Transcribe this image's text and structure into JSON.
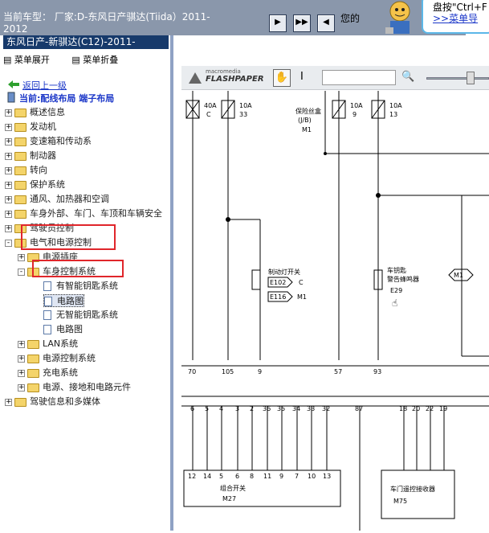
{
  "header": {
    "title": "当前车型： 厂家:D-东风日产骐达(Tiida）2011-2012",
    "message": "您的",
    "help_line1": "盘按\"Ctrl+F",
    "help_line2": ">>菜单导"
  },
  "toolbar": {
    "buttons": [
      {
        "icon": "play-icon"
      },
      {
        "icon": "skip-icon"
      },
      {
        "icon": "prev-icon"
      }
    ]
  },
  "sidebar": {
    "car": "东风日产-新骐达(C12)-2011-",
    "expand": "菜单展开",
    "collapse": "菜单折叠",
    "back": "返回上一级",
    "current": "当前:配线布局 端子布局",
    "items": [
      {
        "label": "概述信息",
        "state": "+",
        "level": 0
      },
      {
        "label": "发动机",
        "state": "+",
        "level": 0
      },
      {
        "label": "变速箱和传动系",
        "state": "+",
        "level": 0
      },
      {
        "label": "制动器",
        "state": "+",
        "level": 0
      },
      {
        "label": "转向",
        "state": "+",
        "level": 0
      },
      {
        "label": "保护系统",
        "state": "+",
        "level": 0
      },
      {
        "label": "通风、加热器和空调",
        "state": "+",
        "level": 0
      },
      {
        "label": "车身外部、车门、车顶和车辆安全",
        "state": "+",
        "level": 0
      },
      {
        "label": "驾驶员控制",
        "state": "+",
        "level": 0
      },
      {
        "label": "电气和电源控制",
        "state": "-",
        "level": 0
      },
      {
        "label": "电源插座",
        "state": "+",
        "level": 1
      },
      {
        "label": "车身控制系统",
        "state": "-",
        "level": 1
      },
      {
        "label": "有智能钥匙系统",
        "state": "",
        "level": 2
      },
      {
        "label": "电路图",
        "state": "",
        "level": 2,
        "selected": true
      },
      {
        "label": "无智能钥匙系统",
        "state": "",
        "level": 2
      },
      {
        "label": "电路图",
        "state": "",
        "level": 2
      },
      {
        "label": "LAN系统",
        "state": "+",
        "level": 1
      },
      {
        "label": "电源控制系统",
        "state": "+",
        "level": 1
      },
      {
        "label": "充电系统",
        "state": "+",
        "level": 1
      },
      {
        "label": "电源、接地和电路元件",
        "state": "+",
        "level": 1
      },
      {
        "label": "驾驶信息和多媒体",
        "state": "+",
        "level": 0
      }
    ]
  },
  "flashpaper": {
    "brand_top": "macromedia",
    "brand": "FLASHPAPER"
  },
  "diagram": {
    "fuses": [
      {
        "amp": "40A",
        "id": "C"
      },
      {
        "amp": "10A",
        "id": "33"
      },
      {
        "amp": "10A",
        "id": "9"
      },
      {
        "amp": "10A",
        "id": "13"
      }
    ],
    "fuse_box": "保险丝盒",
    "fuse_box_code": "(J/B)",
    "fuse_box_conn": "M1",
    "switch": "制动灯开关",
    "switch_conn1": "E102",
    "switch_c": "C",
    "switch_conn2": "E116",
    "switch_m1": "M1",
    "key_label1": "车钥匙",
    "key_label2": "警告蜂鸣器",
    "key_conn": "E29",
    "m1_tag": "M1",
    "pins_top": [
      "70",
      "105",
      "9",
      "57",
      "93"
    ],
    "pins_mid": [
      "6",
      "5",
      "4",
      "3",
      "2",
      "36",
      "35",
      "34",
      "33",
      "32",
      "87",
      "18",
      "20",
      "22",
      "19"
    ],
    "pins_bot": [
      "12",
      "14",
      "5",
      "6",
      "8",
      "11",
      "9",
      "7",
      "10",
      "13"
    ],
    "combo_switch": "组合开关",
    "combo_conn": "M27",
    "receiver": "车门遥控接收器",
    "receiver_conn": "M75"
  }
}
